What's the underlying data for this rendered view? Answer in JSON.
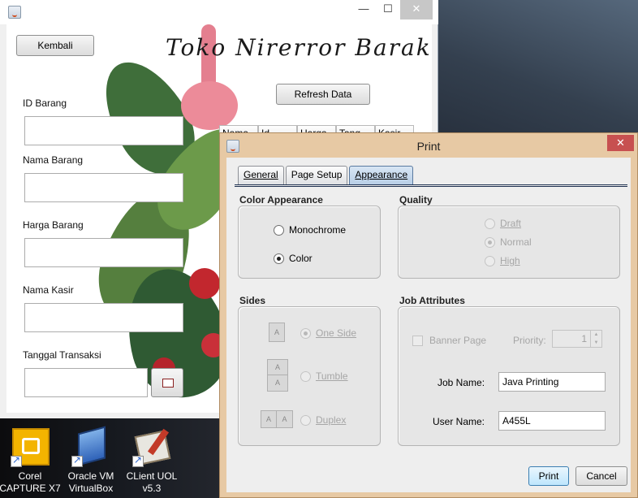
{
  "desktop": {
    "icons": [
      {
        "label_line1": "Corel",
        "label_line2": "CAPTURE X7",
        "icon": "corel-capture-icon"
      },
      {
        "label_line1": "Oracle VM",
        "label_line2": "VirtualBox",
        "icon": "virtualbox-icon"
      },
      {
        "label_line1": "CLient UOL",
        "label_line2": "v5.3",
        "icon": "client-uol-icon"
      }
    ]
  },
  "main_window": {
    "header_title": "Toko Nirerror Barakallah",
    "back_button": "Kembali",
    "refresh_button": "Refresh Data",
    "fields": {
      "id_barang": "ID Barang",
      "nama_barang": "Nama Barang",
      "harga_barang": "Harga Barang",
      "nama_kasir": "Nama Kasir",
      "tanggal_transaksi": "Tanggal Transaksi"
    },
    "table_columns": [
      "Nama",
      "Id",
      "Harga",
      "Tang",
      "Kasir"
    ]
  },
  "print_dialog": {
    "title": "Print",
    "close_glyph": "✕",
    "tabs": [
      "General",
      "Page Setup",
      "Appearance"
    ],
    "active_tab": "Appearance",
    "color_appearance": {
      "title": "Color Appearance",
      "options": [
        "Monochrome",
        "Color"
      ],
      "selected": "Color"
    },
    "quality": {
      "title": "Quality",
      "options": [
        "Draft",
        "Normal",
        "High"
      ],
      "selected": "Normal",
      "enabled": false
    },
    "sides": {
      "title": "Sides",
      "options": [
        "One Side",
        "Tumble",
        "Duplex"
      ],
      "selected": "One Side",
      "enabled": false,
      "sheet_letter": "A"
    },
    "job_attributes": {
      "title": "Job Attributes",
      "banner_page_label": "Banner Page",
      "priority_label": "Priority:",
      "priority_value": "1",
      "job_name_label": "Job Name:",
      "job_name_value": "Java Printing",
      "user_name_label": "User Name:",
      "user_name_value": "A455L"
    },
    "print_button": "Print",
    "cancel_button": "Cancel"
  }
}
